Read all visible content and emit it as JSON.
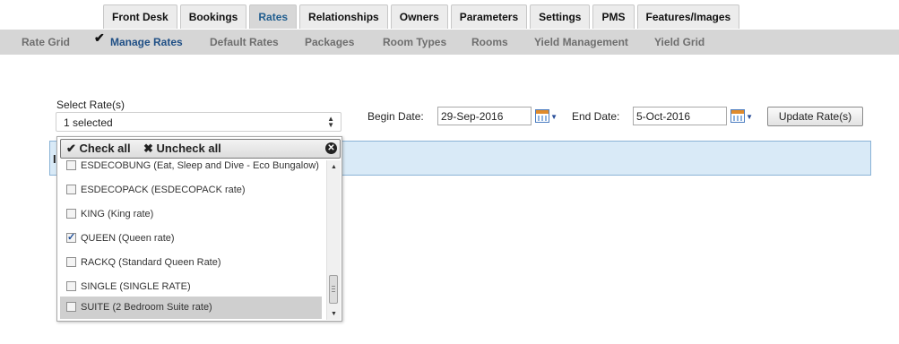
{
  "tabs": [
    {
      "label": "Front Desk"
    },
    {
      "label": "Bookings"
    },
    {
      "label": "Rates"
    },
    {
      "label": "Relationships"
    },
    {
      "label": "Owners"
    },
    {
      "label": "Parameters"
    },
    {
      "label": "Settings"
    },
    {
      "label": "PMS"
    },
    {
      "label": "Features/Images"
    }
  ],
  "active_tab": "Rates",
  "subnav": [
    {
      "label": "Rate Grid"
    },
    {
      "label": "Manage Rates"
    },
    {
      "label": "Default Rates"
    },
    {
      "label": "Packages"
    },
    {
      "label": "Room Types"
    },
    {
      "label": "Rooms"
    },
    {
      "label": "Yield Management"
    },
    {
      "label": "Yield Grid"
    }
  ],
  "active_subnav": "Manage Rates",
  "form": {
    "select_label": "Select Rate(s)",
    "select_value": "1 selected",
    "begin_label": "Begin Date:",
    "begin_value": "29-Sep-2016",
    "end_label": "End Date:",
    "end_value": "5-Oct-2016",
    "update_button": "Update Rate(s)"
  },
  "panel_fragment": "I",
  "dropdown": {
    "check_all": "Check all",
    "uncheck_all": "Uncheck all",
    "options": [
      {
        "label": "ESDECOBUNG (Eat, Sleep and Dive - Eco Bungalow)",
        "checked": false
      },
      {
        "label": "ESDECOPACK (ESDECOPACK rate)",
        "checked": false
      },
      {
        "label": "KING (King rate)",
        "checked": false
      },
      {
        "label": "QUEEN (Queen rate)",
        "checked": true
      },
      {
        "label": "RACKQ (Standard Queen Rate)",
        "checked": false
      },
      {
        "label": "SINGLE (SINGLE RATE)",
        "checked": false
      },
      {
        "label": "SUITE (2 Bedroom Suite rate)",
        "checked": false
      }
    ],
    "highlighted": "SUITE (2 Bedroom Suite rate)"
  },
  "icons": {
    "check_mark": "✔",
    "check_all_icon": "✔",
    "uncheck_all_icon": "✖",
    "close_icon": "✕",
    "calendar_icon": "calendar-icon"
  },
  "colors": {
    "active_tab_text": "#215e8f",
    "active_subnav_text": "#1f4f85",
    "panel_bg": "#d9eaf7"
  }
}
